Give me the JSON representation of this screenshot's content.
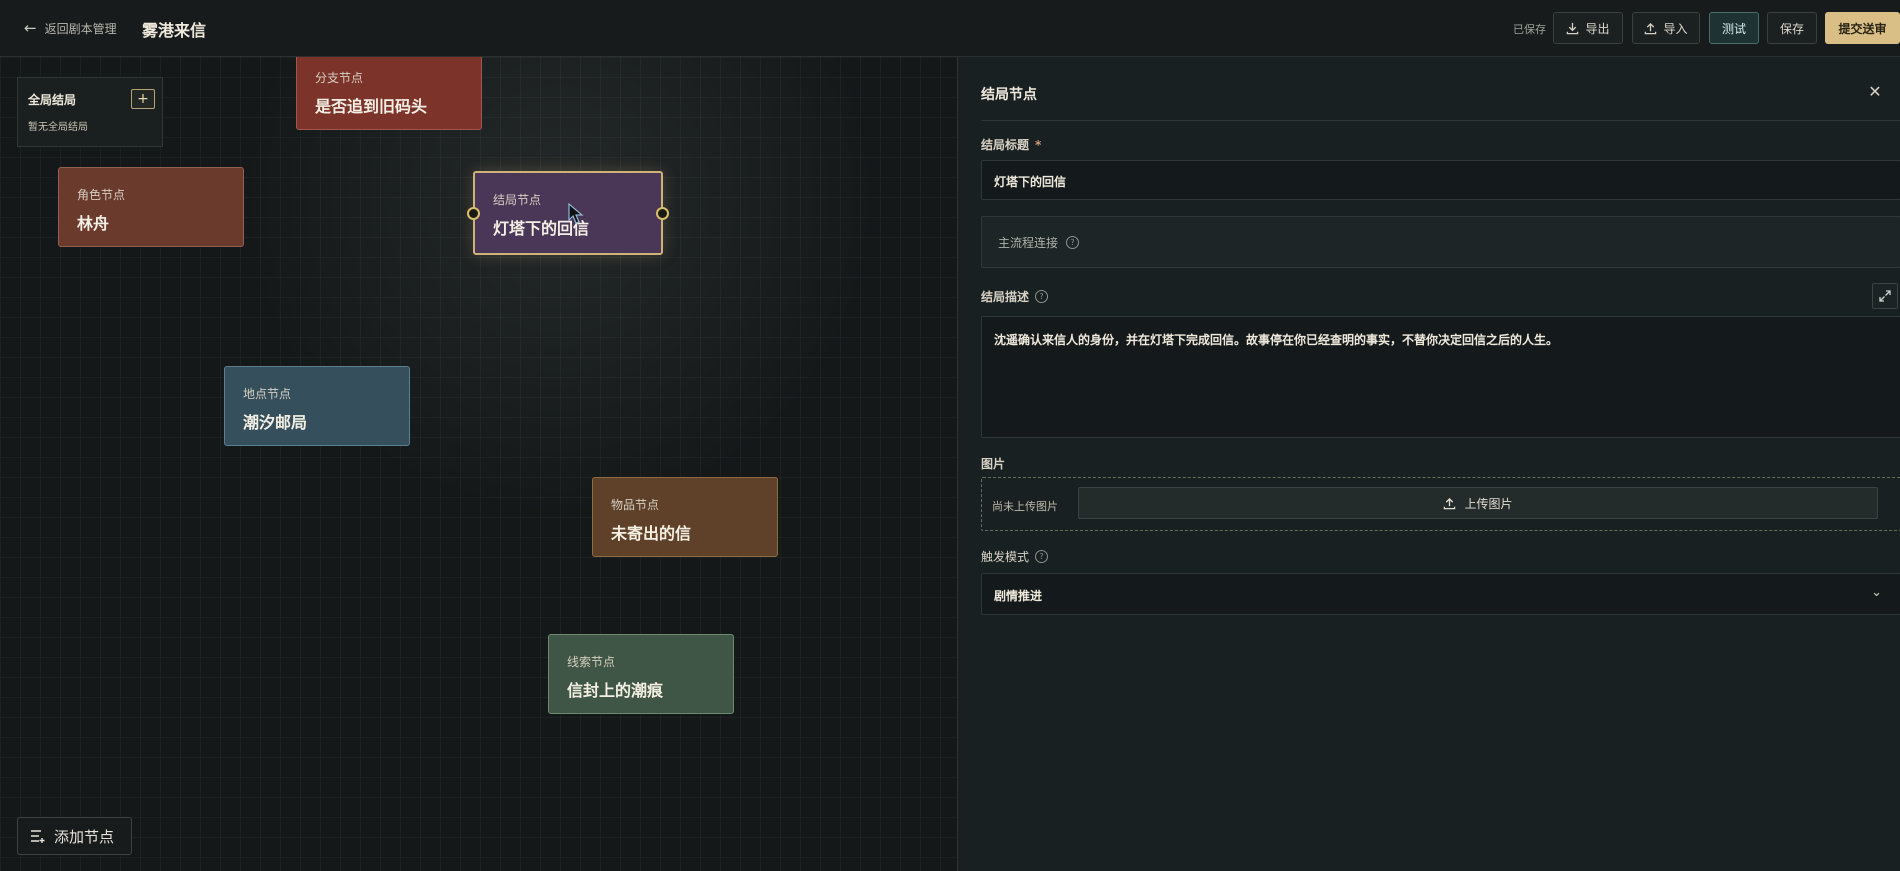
{
  "header": {
    "back_label": "返回剧本管理",
    "title": "雾港来信",
    "saved_status": "已保存",
    "export_label": "导出",
    "import_label": "导入",
    "test_label": "测试",
    "save_label": "保存",
    "submit_label": "提交送审"
  },
  "global_endings": {
    "title": "全局结局",
    "add_label": "+",
    "empty_text": "暂无全局结局"
  },
  "nodes": [
    {
      "type": "分支节点",
      "title": "是否追到旧码头"
    },
    {
      "type": "角色节点",
      "title": "林舟"
    },
    {
      "type": "结局节点",
      "title": "灯塔下的回信"
    },
    {
      "type": "地点节点",
      "title": "潮汐邮局"
    },
    {
      "type": "物品节点",
      "title": "未寄出的信"
    },
    {
      "type": "线索节点",
      "title": "信封上的潮痕"
    }
  ],
  "add_node_label": "添加节点",
  "panel": {
    "title": "结局节点",
    "ending_title_label": "结局标题",
    "required_mark": "*",
    "ending_title_value": "灯塔下的回信",
    "main_flow_label": "主流程连接",
    "description_label": "结局描述",
    "description_value": "沈遥确认来信人的身份，并在灯塔下完成回信。故事停在你已经查明的事实，不替你决定回信之后的人生。",
    "image_label": "图片",
    "image_status": "尚未上传图片",
    "upload_label": "上传图片",
    "trigger_label": "触发模式",
    "trigger_value": "剧情推进"
  },
  "colors": {
    "accent_gold": "#d9bf85",
    "test_teal": "#1e3234",
    "ending_node": "#4a3656",
    "branch_node": "#7c3329",
    "role_node": "#6a3a2c",
    "place_node": "#35505c",
    "item_node": "#5e4128",
    "clue_node": "#3f5545"
  }
}
